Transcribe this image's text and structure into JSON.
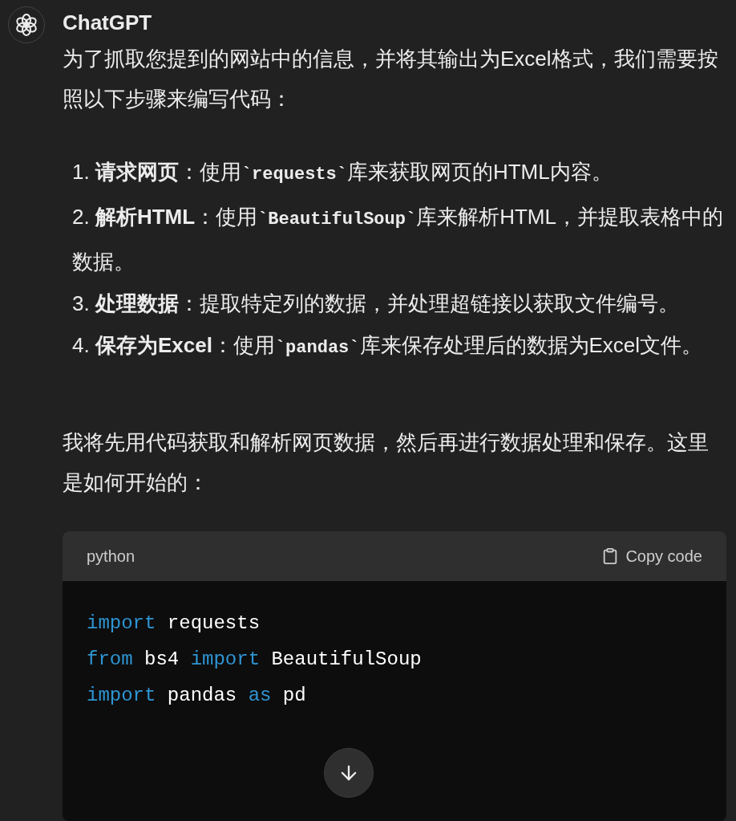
{
  "message": {
    "author": "ChatGPT",
    "intro": "为了抓取您提到的网站中的信息，并将其输出为Excel格式，我们需要按照以下步骤来编写代码：",
    "steps": [
      {
        "number": "1.",
        "title": "请求网页",
        "segments": [
          {
            "kind": "text",
            "text": "：使用"
          },
          {
            "kind": "code",
            "text": "`requests`"
          },
          {
            "kind": "text",
            "text": "库来获取网页的HTML内容。"
          }
        ]
      },
      {
        "number": "2.",
        "title": "解析HTML",
        "segments": [
          {
            "kind": "text",
            "text": "：使用"
          },
          {
            "kind": "code",
            "text": "`BeautifulSoup`"
          },
          {
            "kind": "text",
            "text": "库来解析HTML，并提取表格中的数据。"
          }
        ]
      },
      {
        "number": "3.",
        "title": "处理数据",
        "segments": [
          {
            "kind": "text",
            "text": "：提取特定列的数据，并处理超链接以获取文件编号。"
          }
        ]
      },
      {
        "number": "4.",
        "title": "保存为Excel",
        "segments": [
          {
            "kind": "text",
            "text": "：使用"
          },
          {
            "kind": "code",
            "text": "`pandas`"
          },
          {
            "kind": "text",
            "text": "库来保存处理后的数据为Excel文件。"
          }
        ]
      }
    ],
    "outro": "我将先用代码获取和解析网页数据，然后再进行数据处理和保存。这里是如何开始的：",
    "code_block": {
      "language": "python",
      "copy_label": "Copy code",
      "lines": [
        [
          {
            "kind": "keyword",
            "text": "import"
          },
          {
            "kind": "plain",
            "text": " requests"
          }
        ],
        [
          {
            "kind": "keyword",
            "text": "from"
          },
          {
            "kind": "plain",
            "text": " bs4 "
          },
          {
            "kind": "keyword",
            "text": "import"
          },
          {
            "kind": "plain",
            "text": " BeautifulSoup"
          }
        ],
        [
          {
            "kind": "keyword",
            "text": "import"
          },
          {
            "kind": "plain",
            "text": " pandas "
          },
          {
            "kind": "keyword",
            "text": "as"
          },
          {
            "kind": "plain",
            "text": " pd"
          }
        ]
      ]
    }
  }
}
